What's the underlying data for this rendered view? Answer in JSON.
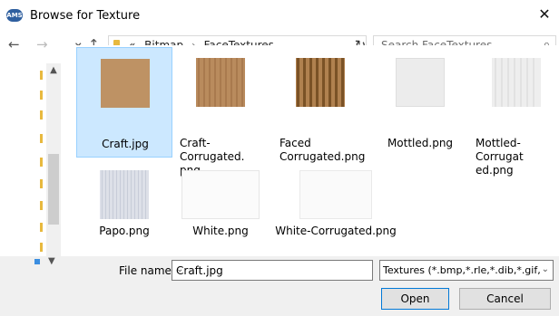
{
  "window": {
    "title": "Browse for Texture",
    "close_glyph": "✕",
    "app_icon_text": "AMS"
  },
  "nav": {
    "back_glyph": "←",
    "forward_glyph": "→",
    "recent_glyph": "⌄",
    "up_glyph": "↑",
    "breadcrumb_overflow": "«",
    "breadcrumb": [
      "Bitmap",
      "FaceTextures"
    ],
    "breadcrumb_sep": "›",
    "address_dropdown_glyph": "⌄",
    "refresh_glyph": "↻",
    "search_placeholder": "Search FaceTextures",
    "search_glyph": "⌕"
  },
  "files": [
    {
      "name": "Craft.jpg",
      "selected": true,
      "texture": "craft"
    },
    {
      "name": "Craft-Corrugated.png",
      "label_lines": [
        "Craft-Corrugated.",
        "png"
      ],
      "selected": false,
      "texture": "craft-corrugated"
    },
    {
      "name": "Faced Corrugated.png",
      "label_lines": [
        "Faced",
        "Corrugated.png"
      ],
      "selected": false,
      "texture": "faced-corrugated"
    },
    {
      "name": "Mottled.png",
      "selected": false,
      "texture": "mottled"
    },
    {
      "name": "Mottled-Corrugated.png",
      "label_lines": [
        "Mottled-Corrugat",
        "ed.png"
      ],
      "selected": false,
      "texture": "mottled-corrugated"
    },
    {
      "name": "Papo.png",
      "selected": false,
      "texture": "papo"
    },
    {
      "name": "White.png",
      "selected": false,
      "texture": "white"
    },
    {
      "name": "White-Corrugated.png",
      "selected": false,
      "texture": "white-corrugated"
    }
  ],
  "footer": {
    "file_name_label": "File name:",
    "file_name_value": "Craft.jpg",
    "file_type_value": "Textures (*.bmp,*.rle,*.dib,*.gif,*.",
    "open_label": "Open",
    "cancel_label": "Cancel"
  },
  "colors": {
    "selection_bg": "#cce8ff",
    "selection_border": "#99d1ff",
    "folder": "#e8b93e",
    "accent": "#0078d7"
  }
}
